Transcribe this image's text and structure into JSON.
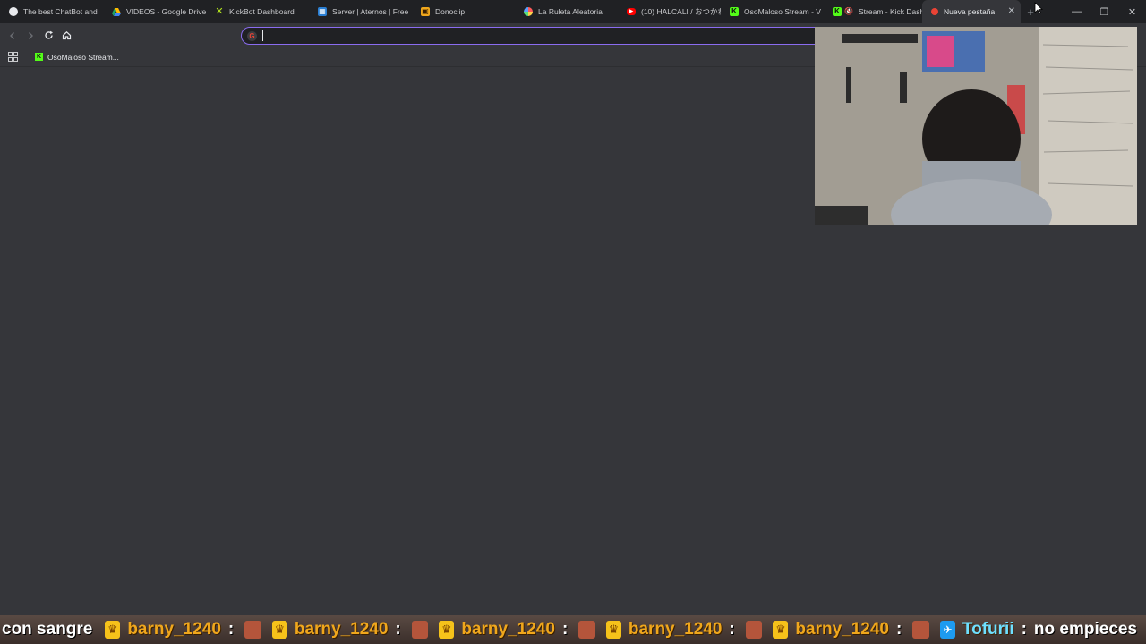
{
  "tabs": [
    {
      "title": "The best ChatBot and",
      "icon": "bot-icon",
      "color": "#e8eaed"
    },
    {
      "title": "VIDEOS - Google Drive",
      "icon": "google-drive-icon",
      "color": "#1fa463"
    },
    {
      "title": "KickBot Dashboard",
      "icon": "kickbot-icon",
      "color": "#b4e61d"
    },
    {
      "title": "Server | Aternos | Free",
      "icon": "aternos-icon",
      "color": "#2a7fd4"
    },
    {
      "title": "Donoclip",
      "icon": "donoclip-icon",
      "color": "#f0a71c"
    },
    {
      "title": "La Ruleta Aleatoria",
      "icon": "roulette-icon",
      "color": "#d66ff0"
    },
    {
      "title": "(10) HALCALI / おつかれ",
      "icon": "youtube-icon",
      "color": "#ff0000"
    },
    {
      "title": "OsoMaloso Stream - V",
      "icon": "kick-icon",
      "color": "#53fc18"
    },
    {
      "title": "Stream - Kick Dash",
      "icon": "kick-icon",
      "color": "#53fc18"
    },
    {
      "title": "Nueva pestaña",
      "icon": "new-tab-icon",
      "color": "#ea4335",
      "active": true
    }
  ],
  "omnibox": {
    "value": "",
    "placeholder": ""
  },
  "bookmarks": [
    {
      "label": "OsoMaloso Stream...",
      "icon": "kick-icon"
    }
  ],
  "ticker": {
    "lead_text": "con sangre",
    "entries": [
      {
        "user": "barny_1240",
        "badge": "crown-icon"
      },
      {
        "user": "barny_1240",
        "badge": "crown-icon"
      },
      {
        "user": "barny_1240",
        "badge": "crown-icon"
      },
      {
        "user": "barny_1240",
        "badge": "crown-icon"
      },
      {
        "user": "barny_1240",
        "badge": "crown-icon"
      }
    ],
    "last_user": "Tofurii",
    "last_message": "no empieces",
    "colon": ":"
  },
  "colors": {
    "tabstrip": "#202124",
    "page": "#35363a",
    "omnibox_border": "#8a6cf0",
    "ticker_user": "#f0a71c",
    "ticker_user_blue": "#6ee0ff"
  }
}
